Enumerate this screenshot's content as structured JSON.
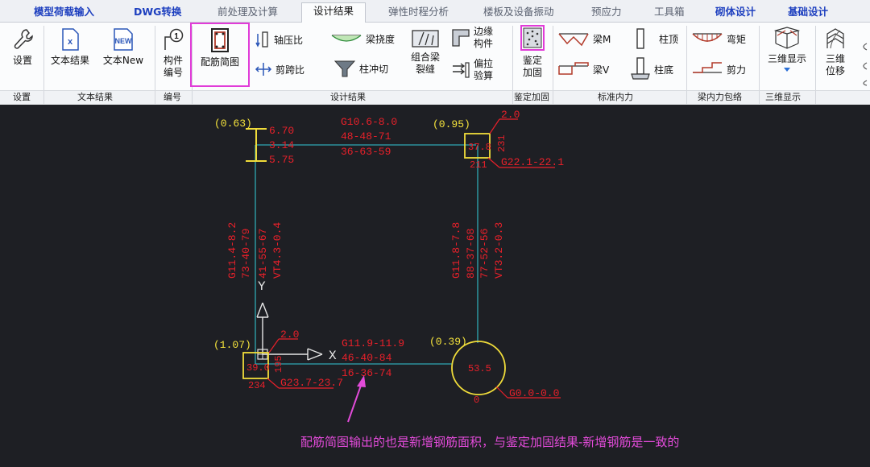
{
  "tabs": [
    {
      "label": "模型荷载输入"
    },
    {
      "label": "DWG转换"
    },
    {
      "label": "前处理及计算"
    },
    {
      "label": "设计结果"
    },
    {
      "label": "弹性时程分析"
    },
    {
      "label": "楼板及设备振动"
    },
    {
      "label": "预应力"
    },
    {
      "label": "工具箱"
    },
    {
      "label": "砌体设计"
    },
    {
      "label": "基础设计"
    }
  ],
  "active_tab": "设计结果",
  "ribbon": {
    "settings": "设置",
    "text_result": "文本结果",
    "text_new": "文本New",
    "new_badge": "NEW",
    "member_number_1": "构件",
    "member_number_2": "编号",
    "member_number_glyph": "1",
    "rebar_diagram": "配筋简图",
    "axial_ratio": "轴压比",
    "shear_span_ratio": "剪跨比",
    "beam_deflection": "梁挠度",
    "column_punching": "柱冲切",
    "composite_beam_crack_1": "组合梁",
    "composite_beam_crack_2": "裂缝",
    "edge_member_1": "边缘",
    "edge_member_2": "构件",
    "eccentric_tension_1": "偏拉",
    "eccentric_tension_2": "验算",
    "appraisal_1": "鉴定",
    "appraisal_2": "加固",
    "beam_m": "梁M",
    "beam_v": "梁V",
    "column_top": "柱顶",
    "column_bottom": "柱底",
    "bending_moment": "弯矩",
    "shear_force": "剪力",
    "three_d_display": "三维显示",
    "three_d_displacement_1": "三维",
    "three_d_displacement_2": "位移"
  },
  "groups": {
    "settings": "设置",
    "text_results": "文本结果",
    "numbering": "编号",
    "design_results": "设计结果",
    "appraisal": "鉴定加固",
    "standard_forces": "标准内力",
    "beam_envelope": "梁内力包络",
    "three_d": "三维显示"
  },
  "drawing": {
    "tl_ratio": "(0.63)",
    "tl_top": "6.70",
    "tl_mid": "3.14",
    "tl_bot": "5.75",
    "top_beam_1": "G10.6-8.0",
    "top_beam_2": "48-48-71",
    "top_beam_3": "36-63-59",
    "tr_ratio": "(0.95)",
    "tr_top": "2.0",
    "tr_value": "37.8",
    "tr_side": "231",
    "tr_bottom": "211",
    "tr_g": "G22.1-22.1",
    "left_beam_1": "G11.4-8.2",
    "left_beam_2": "73-40-79",
    "left_beam_3": "41-55-67",
    "left_beam_4": "VT4.3-0.4",
    "right_beam_1": "G11.8-7.8",
    "right_beam_2": "88-37-68",
    "right_beam_3": "77-52-56",
    "right_beam_4": "VT3.2-0.3",
    "bl_ratio": "(1.07)",
    "bl_top": "2.0",
    "bl_value": "39.0",
    "bl_side": "195",
    "bl_bottom": "234",
    "bl_g": "G23.7-23.7",
    "bottom_beam_1": "G11.9-11.9",
    "bottom_beam_2": "46-40-84",
    "bottom_beam_3": "16-36-74",
    "br_ratio": "(0.39)",
    "br_value": "53.5",
    "br_bottom": "0",
    "br_g": "G0.0-0.0",
    "axis_x": "X",
    "axis_y": "Y"
  },
  "annotation": "配筋简图输出的也是新增钢筋面积，与鉴定加固结果-新增钢筋是一致的",
  "colors": {
    "beam": "#2fa8b3",
    "rebar_text": "#e8202a",
    "ratio_text": "#f5e33c",
    "column_box": "#f0dc3a",
    "highlight": "#e13bd8",
    "annotation": "#e24bd9",
    "active_tab_text": "#111111",
    "tab_text": "#1d3fbf"
  }
}
